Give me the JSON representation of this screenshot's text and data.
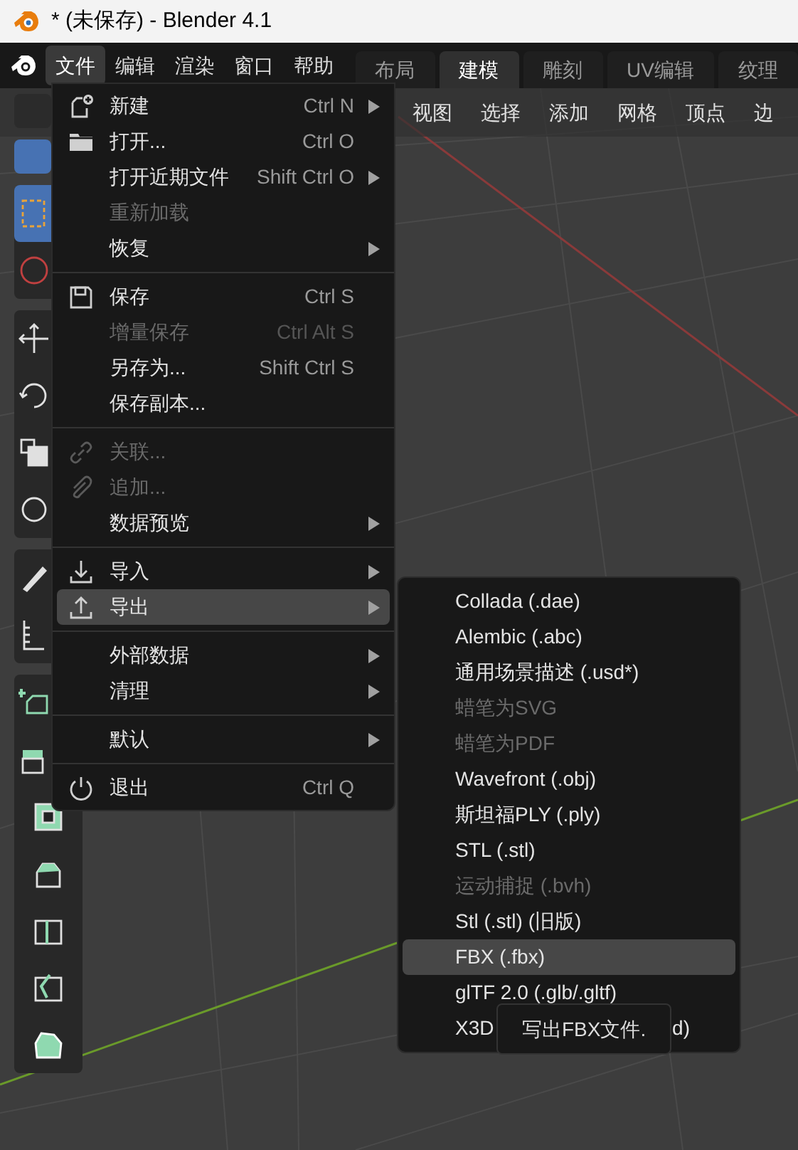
{
  "window": {
    "title": "* (未保存) - Blender 4.1"
  },
  "menubar": [
    {
      "label": "文件",
      "selected": true
    },
    {
      "label": "编辑",
      "selected": false
    },
    {
      "label": "渲染",
      "selected": false
    },
    {
      "label": "窗口",
      "selected": false
    },
    {
      "label": "帮助",
      "selected": false
    }
  ],
  "workspace_tabs": [
    {
      "label": "布局",
      "selected": false
    },
    {
      "label": "建模",
      "selected": true
    },
    {
      "label": "雕刻",
      "selected": false
    },
    {
      "label": "UV编辑",
      "selected": false
    },
    {
      "label": "纹理",
      "selected": false
    }
  ],
  "viewport_header": [
    "视图",
    "选择",
    "添加",
    "网格",
    "顶点",
    "边"
  ],
  "toolbar": {
    "tools": [
      {
        "selected": true
      },
      {
        "selected": false
      },
      {
        "selected": false
      },
      {
        "selected": false
      },
      {
        "selected": false
      },
      {
        "selected": false
      },
      {
        "selected": false
      },
      {
        "selected": false
      },
      {
        "selected": false
      },
      {
        "selected": false
      },
      {
        "selected": false
      },
      {
        "selected": false
      },
      {
        "selected": false
      },
      {
        "selected": false
      },
      {
        "selected": false
      }
    ]
  },
  "file_menu": {
    "groups": [
      [
        {
          "label": "新建",
          "shortcut": "Ctrl N",
          "submenu": true,
          "disabled": false,
          "selected": false
        },
        {
          "label": "打开...",
          "shortcut": "Ctrl O",
          "submenu": false,
          "disabled": false,
          "selected": false
        },
        {
          "label": "打开近期文件",
          "shortcut": "Shift Ctrl O",
          "submenu": true,
          "disabled": false,
          "selected": false
        },
        {
          "label": "重新加载",
          "submenu": false,
          "disabled": true,
          "selected": false
        },
        {
          "label": "恢复",
          "submenu": true,
          "disabled": false,
          "selected": false
        }
      ],
      [
        {
          "label": "保存",
          "shortcut": "Ctrl S",
          "submenu": false,
          "disabled": false,
          "selected": false
        },
        {
          "label": "增量保存",
          "shortcut": "Ctrl Alt S",
          "submenu": false,
          "disabled": true,
          "selected": false
        },
        {
          "label": "另存为...",
          "shortcut": "Shift Ctrl S",
          "submenu": false,
          "disabled": false,
          "selected": false
        },
        {
          "label": "保存副本...",
          "submenu": false,
          "disabled": false,
          "selected": false
        }
      ],
      [
        {
          "label": "关联...",
          "submenu": false,
          "disabled": true,
          "selected": false
        },
        {
          "label": "追加...",
          "submenu": false,
          "disabled": true,
          "selected": false
        },
        {
          "label": "数据预览",
          "submenu": true,
          "disabled": false,
          "selected": false
        }
      ],
      [
        {
          "label": "导入",
          "submenu": true,
          "disabled": false,
          "selected": false
        },
        {
          "label": "导出",
          "submenu": true,
          "disabled": false,
          "selected": true
        }
      ],
      [
        {
          "label": "外部数据",
          "submenu": true,
          "disabled": false,
          "selected": false
        },
        {
          "label": "清理",
          "submenu": true,
          "disabled": false,
          "selected": false
        }
      ],
      [
        {
          "label": "默认",
          "submenu": true,
          "disabled": false,
          "selected": false
        }
      ],
      [
        {
          "label": "退出",
          "shortcut": "Ctrl Q",
          "submenu": false,
          "disabled": false,
          "selected": false
        }
      ]
    ]
  },
  "export_menu": {
    "items": [
      {
        "label": "Collada (.dae)",
        "disabled": false,
        "selected": false
      },
      {
        "label": "Alembic (.abc)",
        "disabled": false,
        "selected": false
      },
      {
        "label": "通用场景描述 (.usd*)",
        "disabled": false,
        "selected": false
      },
      {
        "label": "蜡笔为SVG",
        "disabled": true,
        "selected": false
      },
      {
        "label": "蜡笔为PDF",
        "disabled": true,
        "selected": false
      },
      {
        "label": "Wavefront (.obj)",
        "disabled": false,
        "selected": false
      },
      {
        "label": "斯坦福PLY (.ply)",
        "disabled": false,
        "selected": false
      },
      {
        "label": "STL (.stl)",
        "disabled": false,
        "selected": false
      },
      {
        "label": "运动捕捉 (.bvh)",
        "disabled": true,
        "selected": false
      },
      {
        "label": "Stl (.stl) (旧版)",
        "disabled": false,
        "selected": false
      },
      {
        "label": "FBX (.fbx)",
        "disabled": false,
        "selected": true
      },
      {
        "label": "glTF 2.0 (.glb/.gltf)",
        "disabled": false,
        "selected": false
      },
      {
        "label": "X3D",
        "tail": "d)",
        "disabled": false,
        "selected": false
      }
    ]
  },
  "tooltip": {
    "text": "写出FBX文件."
  }
}
